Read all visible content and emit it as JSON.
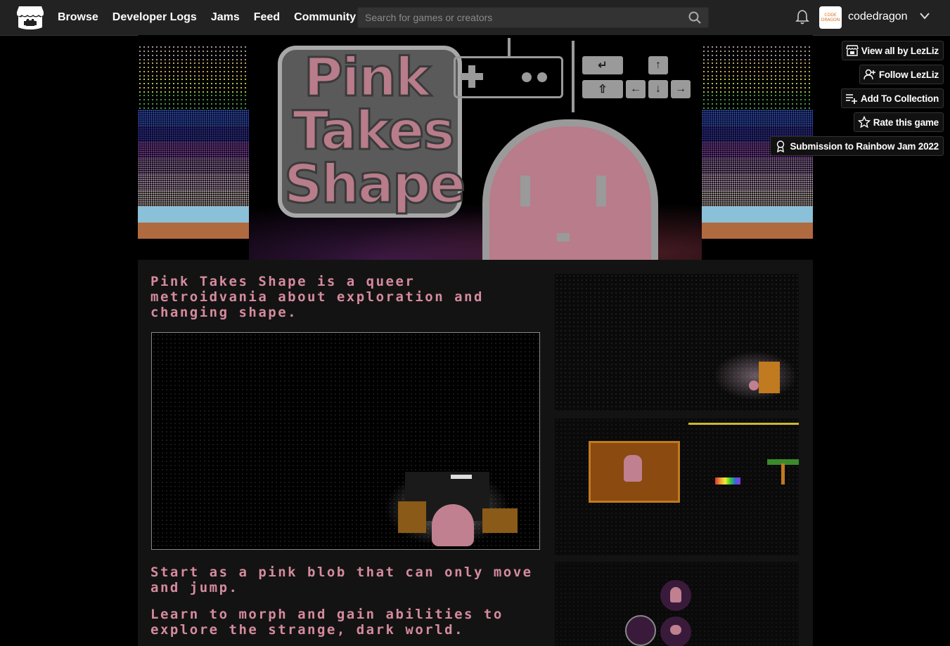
{
  "nav": {
    "items": [
      "Browse",
      "Developer Logs",
      "Jams",
      "Feed",
      "Community"
    ]
  },
  "search": {
    "placeholder": "Search for games or creators"
  },
  "user": {
    "name": "codedragon",
    "avatar_text": "CODE DRAGON"
  },
  "actions": {
    "view_all": "View all by LezLiz",
    "follow": "Follow LezLiz",
    "collection": "Add To Collection",
    "rate": "Rate this game",
    "submission": "Submission to Rainbow Jam 2022"
  },
  "banner": {
    "title_lines": [
      "Pink",
      "Takes",
      "Shape"
    ],
    "stripe_colors": [
      "#b9a7a0",
      "#d4b35a",
      "#c9d24a",
      "#4ca84a",
      "#3a5ad8",
      "#3a3ab0",
      "#8a4ab0",
      "#a07ab0",
      "#c7a7c7",
      "#d0c0c0",
      "#8ac0d8",
      "#b06a40"
    ]
  },
  "description": {
    "intro": "Pink Takes Shape is a queer metroidvania about exploration and changing shape.",
    "p1": "Start as a pink blob that can only move and jump.",
    "p2": "Learn to morph and gain abilities to explore the strange, dark world."
  },
  "colors": {
    "accent_pink": "#d58b9e",
    "topbar": "#222222",
    "content_bg": "#131313"
  }
}
